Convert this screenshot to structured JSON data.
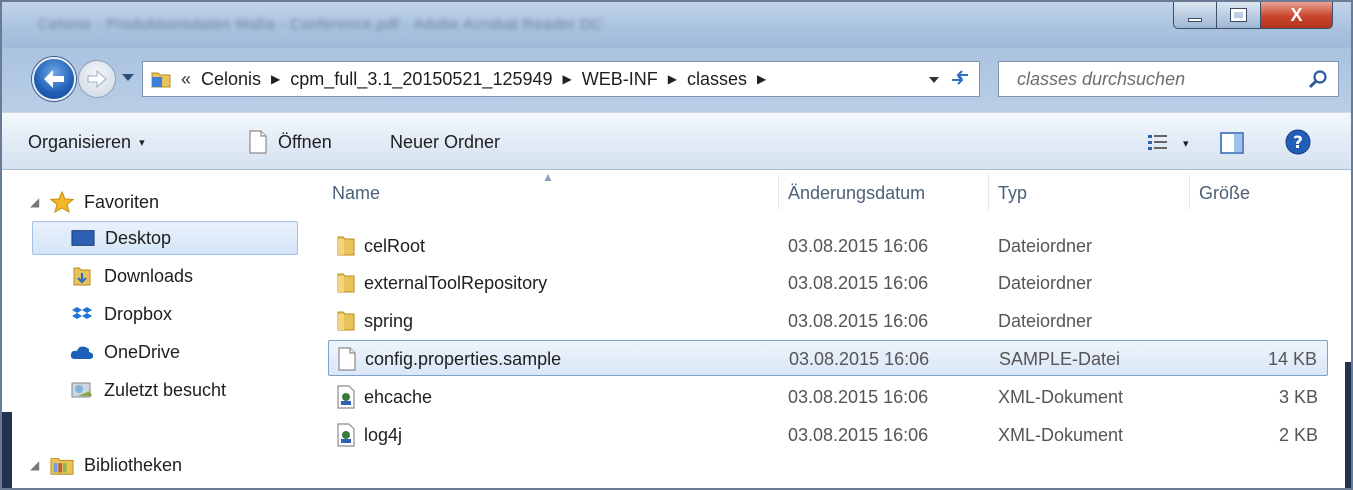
{
  "window": {
    "title": "Celonis - Produktionsdaten Mafia - Conference.pdf - Adobe Acrobat Reader DC",
    "close_glyph": "X"
  },
  "address": {
    "prefix": "«",
    "crumbs": [
      "Celonis",
      "cpm_full_3.1_20150521_125949",
      "WEB-INF",
      "classes"
    ],
    "separator": "▶"
  },
  "search": {
    "placeholder": "classes durchsuchen"
  },
  "toolbar": {
    "organize_label": "Organisieren",
    "open_label": "Öffnen",
    "new_folder_label": "Neuer Ordner",
    "caret": "▾"
  },
  "nav": {
    "favorites": "Favoriten",
    "desktop": "Desktop",
    "downloads": "Downloads",
    "dropbox": "Dropbox",
    "onedrive": "OneDrive",
    "recent": "Zuletzt besucht",
    "libraries": "Bibliotheken"
  },
  "columns": {
    "name": "Name",
    "date": "Änderungsdatum",
    "type": "Typ",
    "size": "Größe"
  },
  "files": [
    {
      "name": "celRoot",
      "date": "03.08.2015 16:06",
      "type": "Dateiordner",
      "size": "",
      "icon": "folder-icon"
    },
    {
      "name": "externalToolRepository",
      "date": "03.08.2015 16:06",
      "type": "Dateiordner",
      "size": "",
      "icon": "folder-icon"
    },
    {
      "name": "spring",
      "date": "03.08.2015 16:06",
      "type": "Dateiordner",
      "size": "",
      "icon": "folder-icon"
    },
    {
      "name": "config.properties.sample",
      "date": "03.08.2015 16:06",
      "type": "SAMPLE-Datei",
      "size": "14 KB",
      "icon": "file-icon",
      "selected": true
    },
    {
      "name": "ehcache",
      "date": "03.08.2015 16:06",
      "type": "XML-Dokument",
      "size": "3 KB",
      "icon": "xml-file-icon"
    },
    {
      "name": "log4j",
      "date": "03.08.2015 16:06",
      "type": "XML-Dokument",
      "size": "2 KB",
      "icon": "xml-file-icon"
    }
  ],
  "colors": {
    "accent": "#3d6fb6",
    "selection_border": "#7da2ce",
    "close_button": "#c9452c",
    "folder": "#e8c35a"
  }
}
